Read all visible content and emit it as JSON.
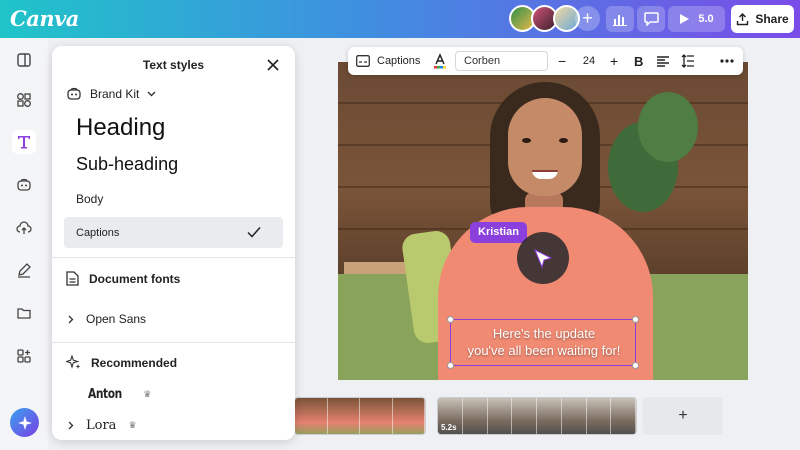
{
  "app": {
    "logo": "Canva"
  },
  "topbar": {
    "play_label": "5.0",
    "share_label": "Share",
    "add_collaborator": "+"
  },
  "panel": {
    "title": "Text styles",
    "brand_kit": "Brand Kit",
    "styles": {
      "heading": "Heading",
      "subheading": "Sub-heading",
      "body": "Body",
      "captions": "Captions"
    },
    "document_fonts": {
      "title": "Document fonts",
      "items": [
        "Open Sans"
      ]
    },
    "recommended": {
      "title": "Recommended",
      "items": [
        "Anton",
        "Lora"
      ]
    }
  },
  "text_toolbar": {
    "style_label": "Captions",
    "font": "Corben",
    "size": "24",
    "decrease": "−",
    "increase": "+",
    "bold": "B"
  },
  "video": {
    "name_tag": "Kristian",
    "caption_line1": "Here's the update",
    "caption_line2": "you've all been waiting for!"
  },
  "timeline": {
    "clip2_duration": "5.2s",
    "add_clip": "+"
  },
  "colors": {
    "accent": "#8b3fdc",
    "topbar_start": "#1fc4c9",
    "topbar_end": "#7a4ce8"
  }
}
